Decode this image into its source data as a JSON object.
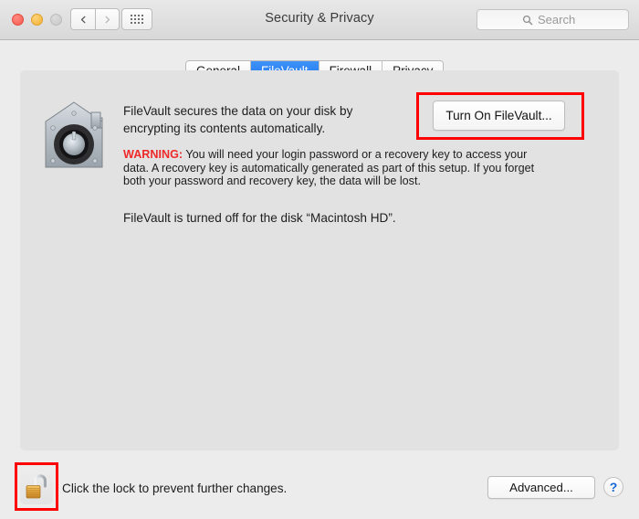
{
  "window": {
    "title": "Security & Privacy",
    "traffic_lights": [
      "close",
      "minimize",
      "zoom-disabled"
    ],
    "nav": {
      "back_icon": "chevron-left-icon",
      "forward_icon": "chevron-right-icon",
      "show_all_icon": "grid-dots-icon"
    }
  },
  "search": {
    "placeholder": "Search",
    "icon": "search-icon",
    "value": ""
  },
  "tabs": [
    {
      "label": "General",
      "active": false
    },
    {
      "label": "FileVault",
      "active": true
    },
    {
      "label": "Firewall",
      "active": false
    },
    {
      "label": "Privacy",
      "active": false
    }
  ],
  "main": {
    "icon": "filevault-safe-icon",
    "description": "FileVault secures the data on your disk by encrypting its contents automatically.",
    "warning_label": "WARNING:",
    "warning_text": " You will need your login password or a recovery key to access your data. A recovery key is automatically generated as part of this setup. If you forget both your password and recovery key, the data will be lost.",
    "status": "FileVault is turned off for the disk “Macintosh HD”.",
    "turn_on_button": "Turn On FileVault..."
  },
  "footer": {
    "lock_icon": "unlocked-padlock-icon",
    "lock_text": "Click the lock to prevent further changes.",
    "advanced_button": "Advanced...",
    "help_button": "?"
  },
  "annotations": {
    "color": "#ff0000",
    "boxes": [
      "turn-on-filevault-button",
      "lock-button"
    ]
  }
}
